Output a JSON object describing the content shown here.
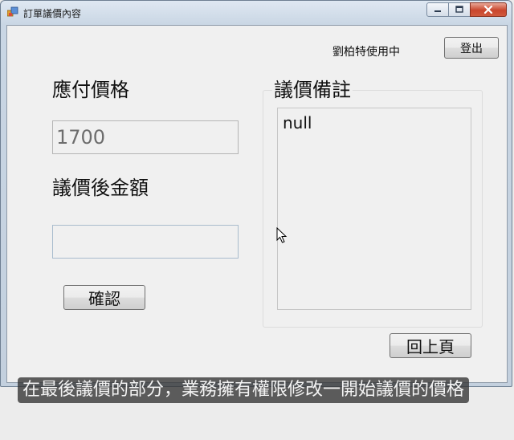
{
  "window": {
    "title": "訂單議價內容",
    "controls": [
      "minimize-icon",
      "maximize-icon",
      "close-icon"
    ]
  },
  "header": {
    "user_status": "劉柏特使用中",
    "logout_label": "登出"
  },
  "form": {
    "payable_label": "應付價格",
    "payable_value": "1700",
    "after_label": "議價後金額",
    "after_value": "",
    "confirm_label": "確認"
  },
  "notes": {
    "title": "議價備註",
    "content": "null"
  },
  "footer": {
    "back_label": "回上頁"
  },
  "subtitle": "在最後議價的部分，業務擁有權限修改一開始議價的價格",
  "colors": {
    "close_button": "#c9462c",
    "client_background": "#f0f0f0",
    "frame": "#c3d0de"
  }
}
